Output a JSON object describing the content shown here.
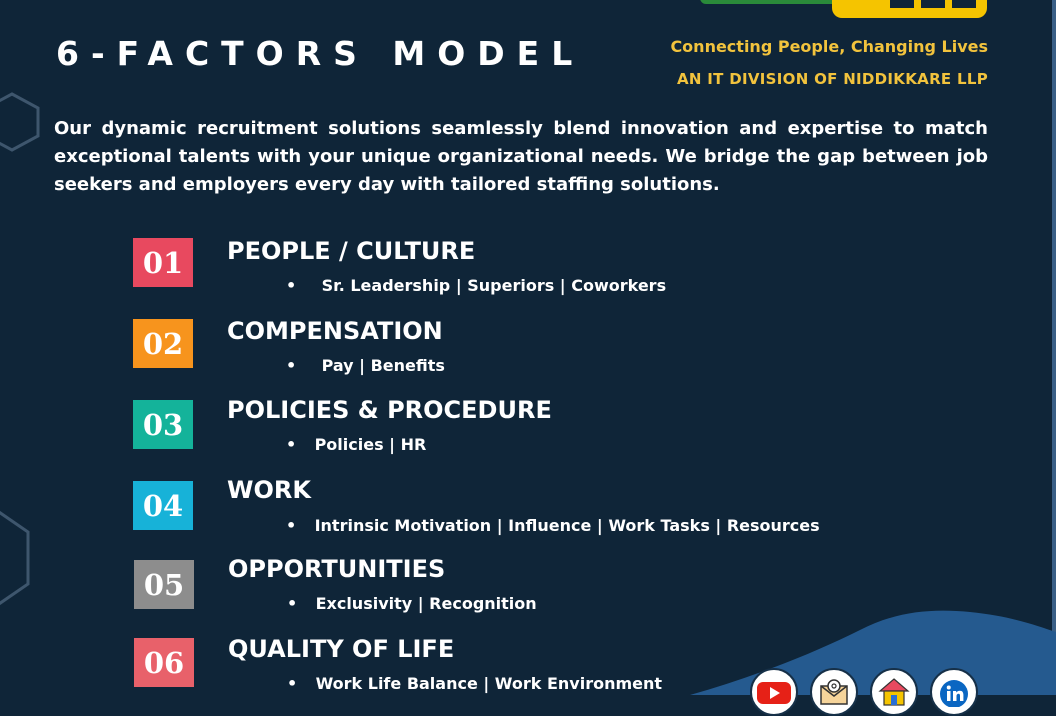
{
  "brand": {
    "tagline": "Connecting People, Changing Lives",
    "division": "AN IT DIVISION OF NIDDIKKARE LLP"
  },
  "title": "6-FACTORS MODEL",
  "intro": "Our dynamic recruitment solutions seamlessly blend innovation and expertise to match exceptional talents with your unique organizational needs. We bridge the gap between job seekers and employers every day with tailored staffing solutions.",
  "factors": [
    {
      "number": "01",
      "title": "PEOPLE / CULTURE",
      "bullet": "•",
      "details": "Sr. Leadership | Superiors | Coworkers",
      "color": "#e8495f"
    },
    {
      "number": "02",
      "title": "COMPENSATION",
      "bullet": "•",
      "details": "Pay | Benefits",
      "color": "#f7941d"
    },
    {
      "number": "03",
      "title": "POLICIES & PROCEDURE",
      "bullet": "•",
      "details": "Policies | HR",
      "color": "#14b39a"
    },
    {
      "number": "04",
      "title": "WORK",
      "bullet": "•",
      "details": "Intrinsic Motivation | Influence | Work Tasks | Resources",
      "color": "#17b2d8"
    },
    {
      "number": "05",
      "title": "OPPORTUNITIES",
      "bullet": "•",
      "details": "Exclusivity | Recognition",
      "color": "#8d8d8d"
    },
    {
      "number": "06",
      "title": "QUALITY OF LIFE",
      "bullet": "•",
      "details": "Work Life Balance | Work Environment",
      "color": "#e8616a"
    }
  ],
  "colors": {
    "background": "#0f2538",
    "accent_yellow": "#f2c33d",
    "wave_blue": "#255a8f"
  },
  "social": [
    {
      "icon": "youtube-icon"
    },
    {
      "icon": "email-icon"
    },
    {
      "icon": "website-home-icon"
    },
    {
      "icon": "linkedin-icon"
    }
  ]
}
